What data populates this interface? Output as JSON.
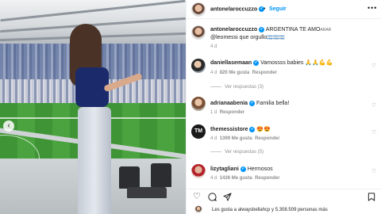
{
  "post": {
    "author": "antonelaroccuzzo",
    "follow_label": "Seguir",
    "dot": "•",
    "caption_line1": "ARGENTINA TE AMO",
    "caption_flag": "ARAR",
    "caption_line2": "@leomessi que orgullo",
    "caption_flags2": "🇦🇷🇦🇷🇦🇷",
    "time": "4 d"
  },
  "comments": [
    {
      "user": "daniellasemaan",
      "text": "Vamossss babies 🙏🙏💪💪",
      "time": "4 d",
      "likes": "820 Me gusta",
      "reply": "Responder",
      "view_replies": "Ver respuestas (3)"
    },
    {
      "user": "adrianaabenia",
      "text": "Familia bella!",
      "time": "1 d",
      "likes": "",
      "reply": "Responder",
      "view_replies": ""
    },
    {
      "user": "themessistore",
      "text": "😍😍",
      "time": "4 d",
      "likes": "1399 Me gusta",
      "reply": "Responder",
      "view_replies": "Ver respuestas (5)"
    },
    {
      "user": "lizytagliani",
      "text": "Hermosos",
      "time": "4 d",
      "likes": "1436 Me gusta",
      "reply": "Responder",
      "view_replies": ""
    }
  ],
  "footer": {
    "likes_text": "Les gusta a alwaysbellahcp y 5.308.509 personas más"
  },
  "icons": {
    "heart": "heart-icon",
    "comment": "comment-icon",
    "share": "share-icon",
    "save": "bookmark-icon",
    "more": "more-icon",
    "prev": "chevron-left-icon"
  },
  "colors": {
    "accent": "#0095f6",
    "verified": "#0095f6",
    "muted": "#8e8e8e"
  }
}
